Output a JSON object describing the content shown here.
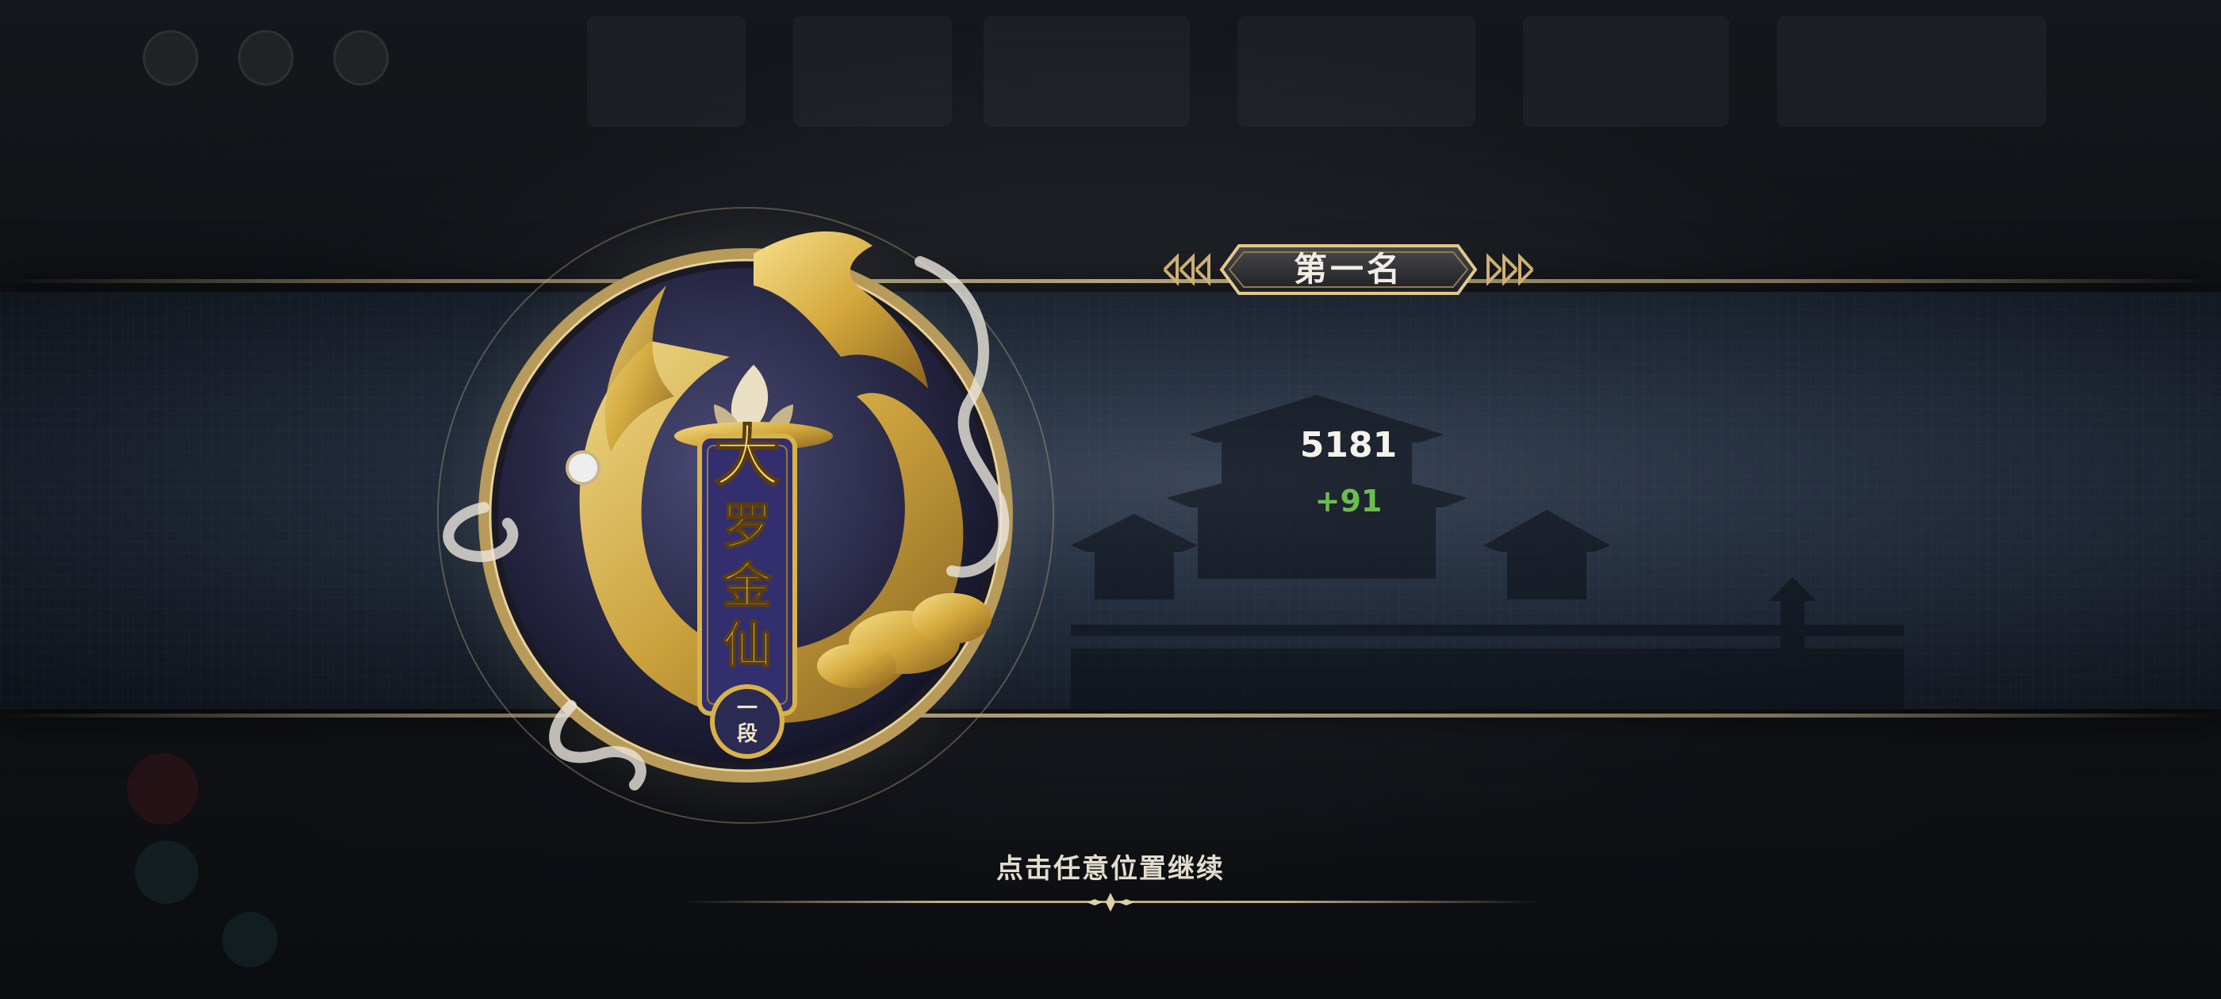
{
  "rank": {
    "label": "第一名"
  },
  "result": {
    "score": "5181",
    "delta": "+91"
  },
  "emblem": {
    "title_chars": [
      "大",
      "罗",
      "金",
      "仙"
    ],
    "tier_lines": [
      "一",
      "段"
    ]
  },
  "prompt": {
    "continue_text": "点击任意位置继续"
  },
  "colors": {
    "gold": "#d8b24a",
    "delta_green": "#6cbe4c",
    "banner_purple": "#332f6e",
    "band_blue": "#253041"
  },
  "icons": [
    "settings-icon",
    "chat-icon",
    "cards-icon",
    "dragon-emblem-icon",
    "lotus-icon",
    "pearl-icon",
    "cloud-icon"
  ]
}
